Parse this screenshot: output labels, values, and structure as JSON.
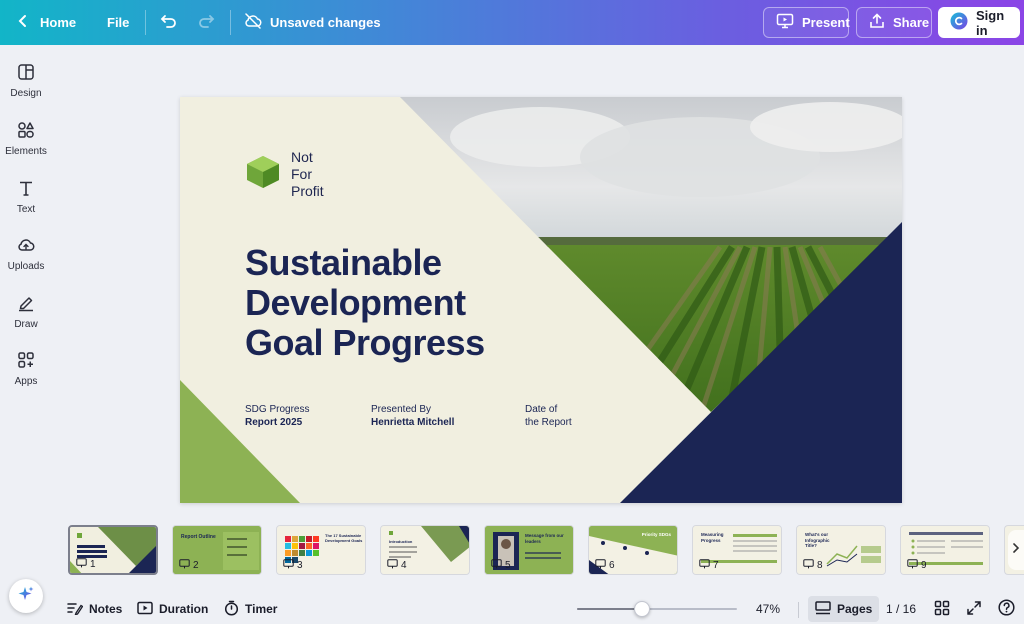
{
  "topbar": {
    "home_label": "Home",
    "file_label": "File",
    "status_text": "Unsaved changes",
    "present_label": "Present",
    "share_label": "Share",
    "signin_label": "Sign in"
  },
  "sidebar": {
    "items": [
      {
        "label": "Design",
        "icon": "layout-icon"
      },
      {
        "label": "Elements",
        "icon": "shapes-icon"
      },
      {
        "label": "Text",
        "icon": "text-icon"
      },
      {
        "label": "Uploads",
        "icon": "cloud-upload-icon"
      },
      {
        "label": "Draw",
        "icon": "pen-icon"
      },
      {
        "label": "Apps",
        "icon": "apps-icon"
      }
    ]
  },
  "slide": {
    "logo_lines": [
      "Not",
      "For",
      "Profit"
    ],
    "title_lines": [
      "Sustainable",
      "Development",
      "Goal Progress"
    ],
    "meta": [
      {
        "line1": "SDG Progress",
        "line2": "Report 2025"
      },
      {
        "line1": "Presented By",
        "line2": "Henrietta Mitchell"
      },
      {
        "line1": "Date of",
        "line2": "the Report"
      }
    ],
    "colors": {
      "cream": "#f1efe0",
      "green": "#8db254",
      "navy": "#1b2554"
    }
  },
  "pages": {
    "thumbnails": [
      {
        "number": "1",
        "caption": ""
      },
      {
        "number": "2",
        "caption": "Report Outline"
      },
      {
        "number": "3",
        "caption": "The 17 Sustainable Development Goals"
      },
      {
        "number": "4",
        "caption": "Introduction"
      },
      {
        "number": "5",
        "caption": "Message from our leaders"
      },
      {
        "number": "6",
        "caption": "Priority SDGs"
      },
      {
        "number": "7",
        "caption": "Measuring Progress"
      },
      {
        "number": "8",
        "caption": "What's our Infographic Title?"
      },
      {
        "number": "9",
        "caption": ""
      }
    ]
  },
  "bottombar": {
    "notes_label": "Notes",
    "duration_label": "Duration",
    "timer_label": "Timer",
    "zoom_value": "47%",
    "zoom_fraction": 0.47,
    "pages_label": "Pages",
    "page_counter": "1 / 16"
  }
}
